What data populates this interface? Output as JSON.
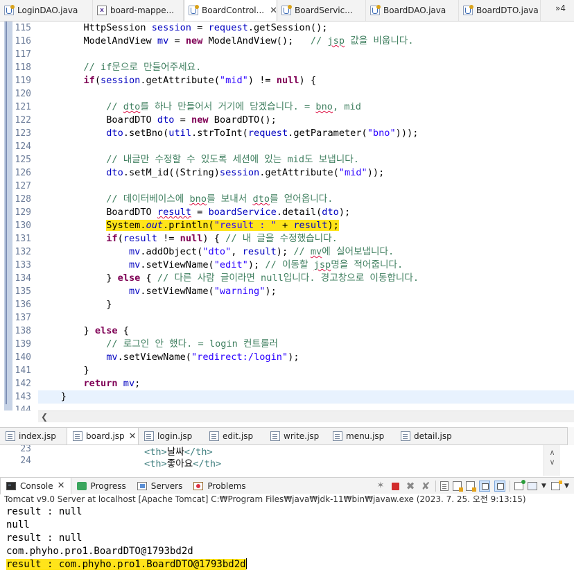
{
  "editor_tabs": [
    {
      "label": "LoginDAO.java",
      "icon": "java-file-icon"
    },
    {
      "label": "board-mappe...",
      "icon": "xml-file-icon"
    },
    {
      "label": "BoardControl...",
      "icon": "java-file-icon",
      "active": true,
      "close": "✕"
    },
    {
      "label": "BoardServic...",
      "icon": "java-file-icon"
    },
    {
      "label": "BoardDAO.java",
      "icon": "java-file-icon"
    },
    {
      "label": "BoardDTO.java",
      "icon": "java-file-icon"
    }
  ],
  "tab_overflow": "»4",
  "line_numbers": [
    "115",
    "116",
    "117",
    "118",
    "119",
    "120",
    "121",
    "122",
    "123",
    "124",
    "125",
    "126",
    "127",
    "128",
    "129",
    "130",
    "131",
    "132",
    "133",
    "134",
    "135",
    "136",
    "137",
    "138",
    "139",
    "140",
    "141",
    "142",
    "143",
    "144"
  ],
  "code": {
    "l115": {
      "t1": "HttpSession ",
      "t2": "session",
      "t3": " = ",
      "t4": "request",
      "t5": ".getSession();"
    },
    "l116": {
      "t1": "ModelAndView ",
      "t2": "mv",
      "t3": " = ",
      "kw": "new",
      "t4": " ModelAndView();   ",
      "cm1": "// ",
      "cm2": "jsp",
      "cm3": " 값을 비웁니다."
    },
    "l118": {
      "cm": "// if문으로 만들어주세요."
    },
    "l119": {
      "kw": "if",
      "t1": "(",
      "t2": "session",
      "t3": ".getAttribute(",
      "st": "\"mid\"",
      "t4": ") != ",
      "kw2": "null",
      "t5": ") {"
    },
    "l121": {
      "cm1": "// ",
      "cm2": "dto",
      "cm3": "를 하나 만들어서 거기에 담겠습니다. = ",
      "cm4": "bno",
      "cm5": ", mid"
    },
    "l122": {
      "t1": "BoardDTO ",
      "t2": "dto",
      "t3": " = ",
      "kw": "new",
      "t4": " BoardDTO();"
    },
    "l123": {
      "t1": "dto",
      "t2": ".setBno(",
      "t3": "util",
      "t4": ".strToInt(",
      "t5": "request",
      "t6": ".getParameter(",
      "st": "\"bno\"",
      "t7": ")));"
    },
    "l125": {
      "cm": "// 내글만 수정할 수 있도록 세션에 있는 mid도 보냅니다."
    },
    "l126": {
      "t1": "dto",
      "t2": ".setM_id((String)",
      "t3": "session",
      "t4": ".getAttribute(",
      "st": "\"mid\"",
      "t5": "));"
    },
    "l128": {
      "cm1": "// 데이터베이스에 ",
      "cm2": "bno",
      "cm3": "를 보내서 ",
      "cm4": "dto",
      "cm5": "를 얻어옵니다."
    },
    "l129": {
      "t1": "BoardDTO ",
      "t2": "result",
      "t3": " = ",
      "t4": "boardService",
      "t5": ".detail(",
      "t6": "dto",
      "t7": ");"
    },
    "l130": {
      "t1": "System.",
      "t2": "out",
      "t3": ".println(",
      "st": "\"result : \"",
      "t4": " + ",
      "t5": "result",
      "t6": ");"
    },
    "l131": {
      "kw": "if",
      "t1": "(",
      "t2": "result",
      "t3": " != ",
      "kw2": "null",
      "t4": ") { ",
      "cm": "// 내 글을 수정했습니다."
    },
    "l132": {
      "t1": "mv",
      "t2": ".addObject(",
      "st": "\"dto\"",
      "t3": ", ",
      "t4": "result",
      "t5": "); ",
      "cm1": "// ",
      "cm2": "mv",
      "cm3": "에 실어보냅니다."
    },
    "l133": {
      "t1": "mv",
      "t2": ".setViewName(",
      "st": "\"edit\"",
      "t3": "); ",
      "cm1": "// 이동할 ",
      "cm2": "jsp",
      "cm3": "명을 적어줍니다."
    },
    "l134": {
      "t1": "} ",
      "kw": "else",
      "t2": " { ",
      "cm": "// 다른 사람 글이라면 null입니다. 경고창으로 이동합니다."
    },
    "l135": {
      "t1": "mv",
      "t2": ".setViewName(",
      "st": "\"warning\"",
      "t3": ");"
    },
    "l136": {
      "t1": "}"
    },
    "l138": {
      "t1": "} ",
      "kw": "else",
      "t2": " {"
    },
    "l139": {
      "cm": "// 로그인 안 했다. = login 컨트롤러"
    },
    "l140": {
      "t1": "mv",
      "t2": ".setViewName(",
      "st": "\"redirect:/login\"",
      "t3": ");"
    },
    "l141": {
      "t1": "}"
    },
    "l142": {
      "kw": "return",
      "t1": " ",
      "t2": "mv",
      "t3": ";"
    },
    "l143": {
      "t1": "}"
    }
  },
  "jsp_tabs": [
    {
      "label": "index.jsp"
    },
    {
      "label": "board.jsp",
      "active": true,
      "close": "✕"
    },
    {
      "label": "login.jsp"
    },
    {
      "label": "edit.jsp"
    },
    {
      "label": "write.jsp"
    },
    {
      "label": "menu.jsp"
    },
    {
      "label": "detail.jsp"
    }
  ],
  "jsp_view": {
    "line1_no": "23",
    "line1_open": "<th>",
    "line1_text": "날싸",
    "line1_close": "</th>",
    "line2_no": "24",
    "line2_open": "<th>",
    "line2_text": "좋아요",
    "line2_close": "</th>"
  },
  "console_tabs": [
    {
      "label": "Console",
      "icon": "console-icon",
      "active": true,
      "close": "✕"
    },
    {
      "label": "Progress",
      "icon": "progress-icon"
    },
    {
      "label": "Servers",
      "icon": "servers-icon"
    },
    {
      "label": "Problems",
      "icon": "problems-icon"
    }
  ],
  "console": {
    "header": "Tomcat v9.0 Server at localhost [Apache Tomcat] C:₩Program Files₩java₩jdk-11₩bin₩javaw.exe  (2023. 7. 25. 오전 9:13:15)",
    "lines": [
      "result : null",
      "null",
      "result : null",
      "com.phyho.pro1.BoardDTO@1793bd2d"
    ],
    "last_line": "result : com.phyho.pro1.BoardDTO@1793bd2d"
  },
  "colors": {
    "keyword": "#7f0055",
    "comment": "#3f7f5f",
    "string": "#2a00ff",
    "field": "#0000c0",
    "highlight": "#ffe41a",
    "current_line": "#e8f2fe"
  }
}
